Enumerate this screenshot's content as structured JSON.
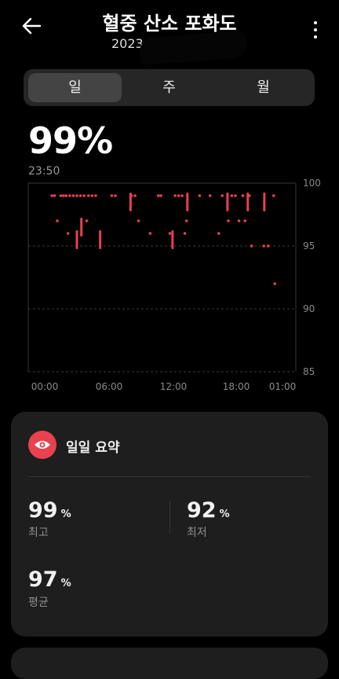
{
  "header": {
    "title": "혈중 산소 포화도",
    "subtitle": "2023",
    "back_icon": "arrow-left-icon",
    "more_icon": "more-vertical-icon"
  },
  "tabs": [
    {
      "label": "일",
      "active": true
    },
    {
      "label": "주",
      "active": false
    },
    {
      "label": "월",
      "active": false
    }
  ],
  "current": {
    "value": "99%",
    "time": "23:50"
  },
  "chart_data": {
    "type": "scatter",
    "title": "",
    "xlabel": "",
    "ylabel": "",
    "x_ticks": [
      "00:00",
      "06:00",
      "12:00",
      "18:00",
      "01:00"
    ],
    "y_ticks": [
      "100",
      "95",
      "90",
      "85"
    ],
    "ylim": [
      85,
      100
    ],
    "grid": true,
    "color": "#e8414f",
    "points": [
      {
        "x": "00:40",
        "y": 99
      },
      {
        "x": "00:55",
        "y": 99
      },
      {
        "x": "01:10",
        "y": 97
      },
      {
        "x": "01:30",
        "y": 99
      },
      {
        "x": "01:45",
        "y": 99
      },
      {
        "x": "02:00",
        "y": 99
      },
      {
        "x": "02:10",
        "y": 96
      },
      {
        "x": "02:20",
        "y": 99
      },
      {
        "x": "02:40",
        "y": 99
      },
      {
        "x": "03:00",
        "y": 99
      },
      {
        "x": "03:20",
        "y": 99
      },
      {
        "x": "03:40",
        "y": 99
      },
      {
        "x": "03:55",
        "y": 97
      },
      {
        "x": "04:05",
        "y": 99
      },
      {
        "x": "04:25",
        "y": 99
      },
      {
        "x": "04:45",
        "y": 99
      },
      {
        "x": "06:15",
        "y": 99
      },
      {
        "x": "06:35",
        "y": 99
      },
      {
        "x": "08:05",
        "y": 99
      },
      {
        "x": "08:25",
        "y": 99
      },
      {
        "x": "08:45",
        "y": 97
      },
      {
        "x": "09:50",
        "y": 96
      },
      {
        "x": "10:35",
        "y": 99
      },
      {
        "x": "10:50",
        "y": 99
      },
      {
        "x": "11:40",
        "y": 96
      },
      {
        "x": "12:10",
        "y": 99
      },
      {
        "x": "12:30",
        "y": 99
      },
      {
        "x": "12:50",
        "y": 99
      },
      {
        "x": "13:05",
        "y": 96
      },
      {
        "x": "13:15",
        "y": 97
      },
      {
        "x": "14:30",
        "y": 99
      },
      {
        "x": "15:30",
        "y": 99
      },
      {
        "x": "16:20",
        "y": 96
      },
      {
        "x": "16:40",
        "y": 99
      },
      {
        "x": "17:15",
        "y": 97
      },
      {
        "x": "17:35",
        "y": 99
      },
      {
        "x": "17:55",
        "y": 99
      },
      {
        "x": "18:25",
        "y": 97
      },
      {
        "x": "19:00",
        "y": 99
      },
      {
        "x": "19:20",
        "y": 97
      },
      {
        "x": "20:00",
        "y": 99
      },
      {
        "x": "20:20",
        "y": 95
      },
      {
        "x": "22:10",
        "y": 95
      },
      {
        "x": "22:50",
        "y": 95
      },
      {
        "x": "23:40",
        "y": 99
      },
      {
        "x": "23:50",
        "y": 92
      }
    ],
    "ranges": [
      {
        "x": "03:00",
        "low": 95,
        "high": 96
      },
      {
        "x": "03:25",
        "low": 96,
        "high": 97
      },
      {
        "x": "05:10",
        "low": 95,
        "high": 96
      },
      {
        "x": "08:00",
        "low": 98,
        "high": 99
      },
      {
        "x": "11:55",
        "low": 95,
        "high": 96
      },
      {
        "x": "13:20",
        "low": 98,
        "high": 99
      },
      {
        "x": "17:10",
        "low": 98,
        "high": 99
      },
      {
        "x": "19:45",
        "low": 98,
        "high": 99
      },
      {
        "x": "22:15",
        "low": 98,
        "high": 99
      }
    ]
  },
  "summary": {
    "title": "일일 요약",
    "icon": "eye-icon",
    "max": {
      "value": "99",
      "unit": "%",
      "label": "최고"
    },
    "min": {
      "value": "92",
      "unit": "%",
      "label": "최저"
    },
    "avg": {
      "value": "97",
      "unit": "%",
      "label": "평균"
    }
  }
}
